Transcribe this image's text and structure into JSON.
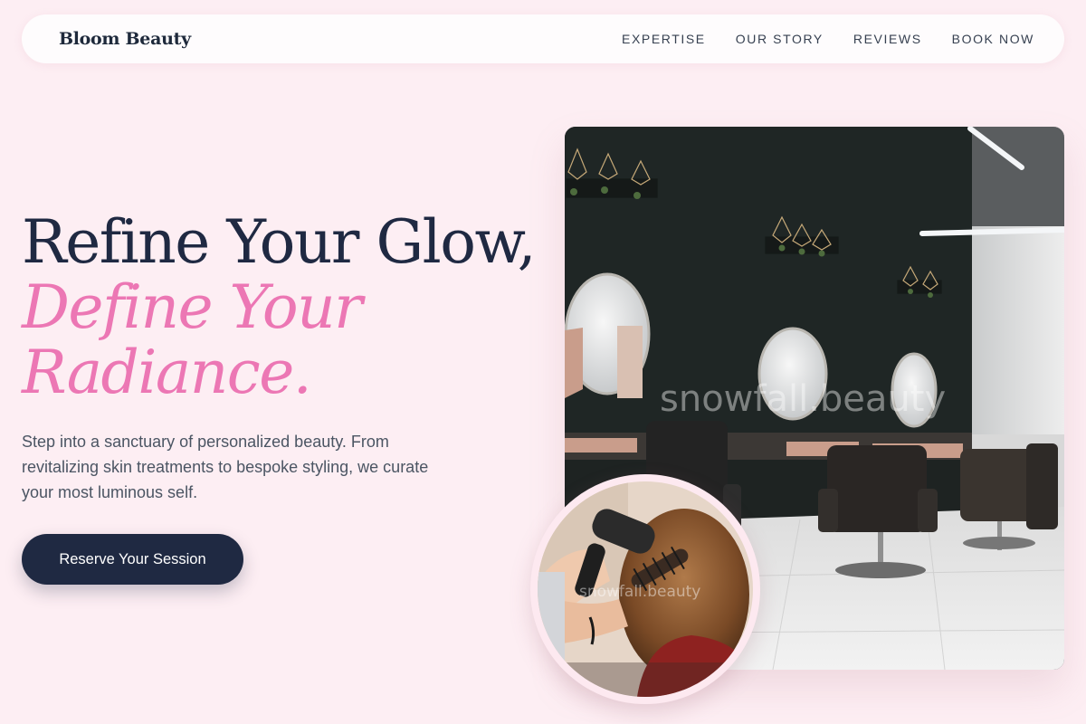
{
  "header": {
    "logo": "Bloom Beauty",
    "nav": [
      {
        "label": "EXPERTISE"
      },
      {
        "label": "OUR STORY"
      },
      {
        "label": "REVIEWS"
      },
      {
        "label": "BOOK NOW"
      }
    ]
  },
  "hero": {
    "title_line1": "Refine Your Glow,",
    "title_line2": "Define Your",
    "title_line3": "Radiance.",
    "description": "Step into a sanctuary of personalized beauty. From revitalizing skin treatments to bespoke styling, we curate your most luminous self.",
    "cta_label": "Reserve Your Session"
  },
  "images": {
    "main_watermark": "snowfall.beauty",
    "inset_watermark": "snowfall.beauty"
  },
  "colors": {
    "background": "#fdeef3",
    "accent_pink": "#ec77b4",
    "navy": "#1f2942"
  }
}
